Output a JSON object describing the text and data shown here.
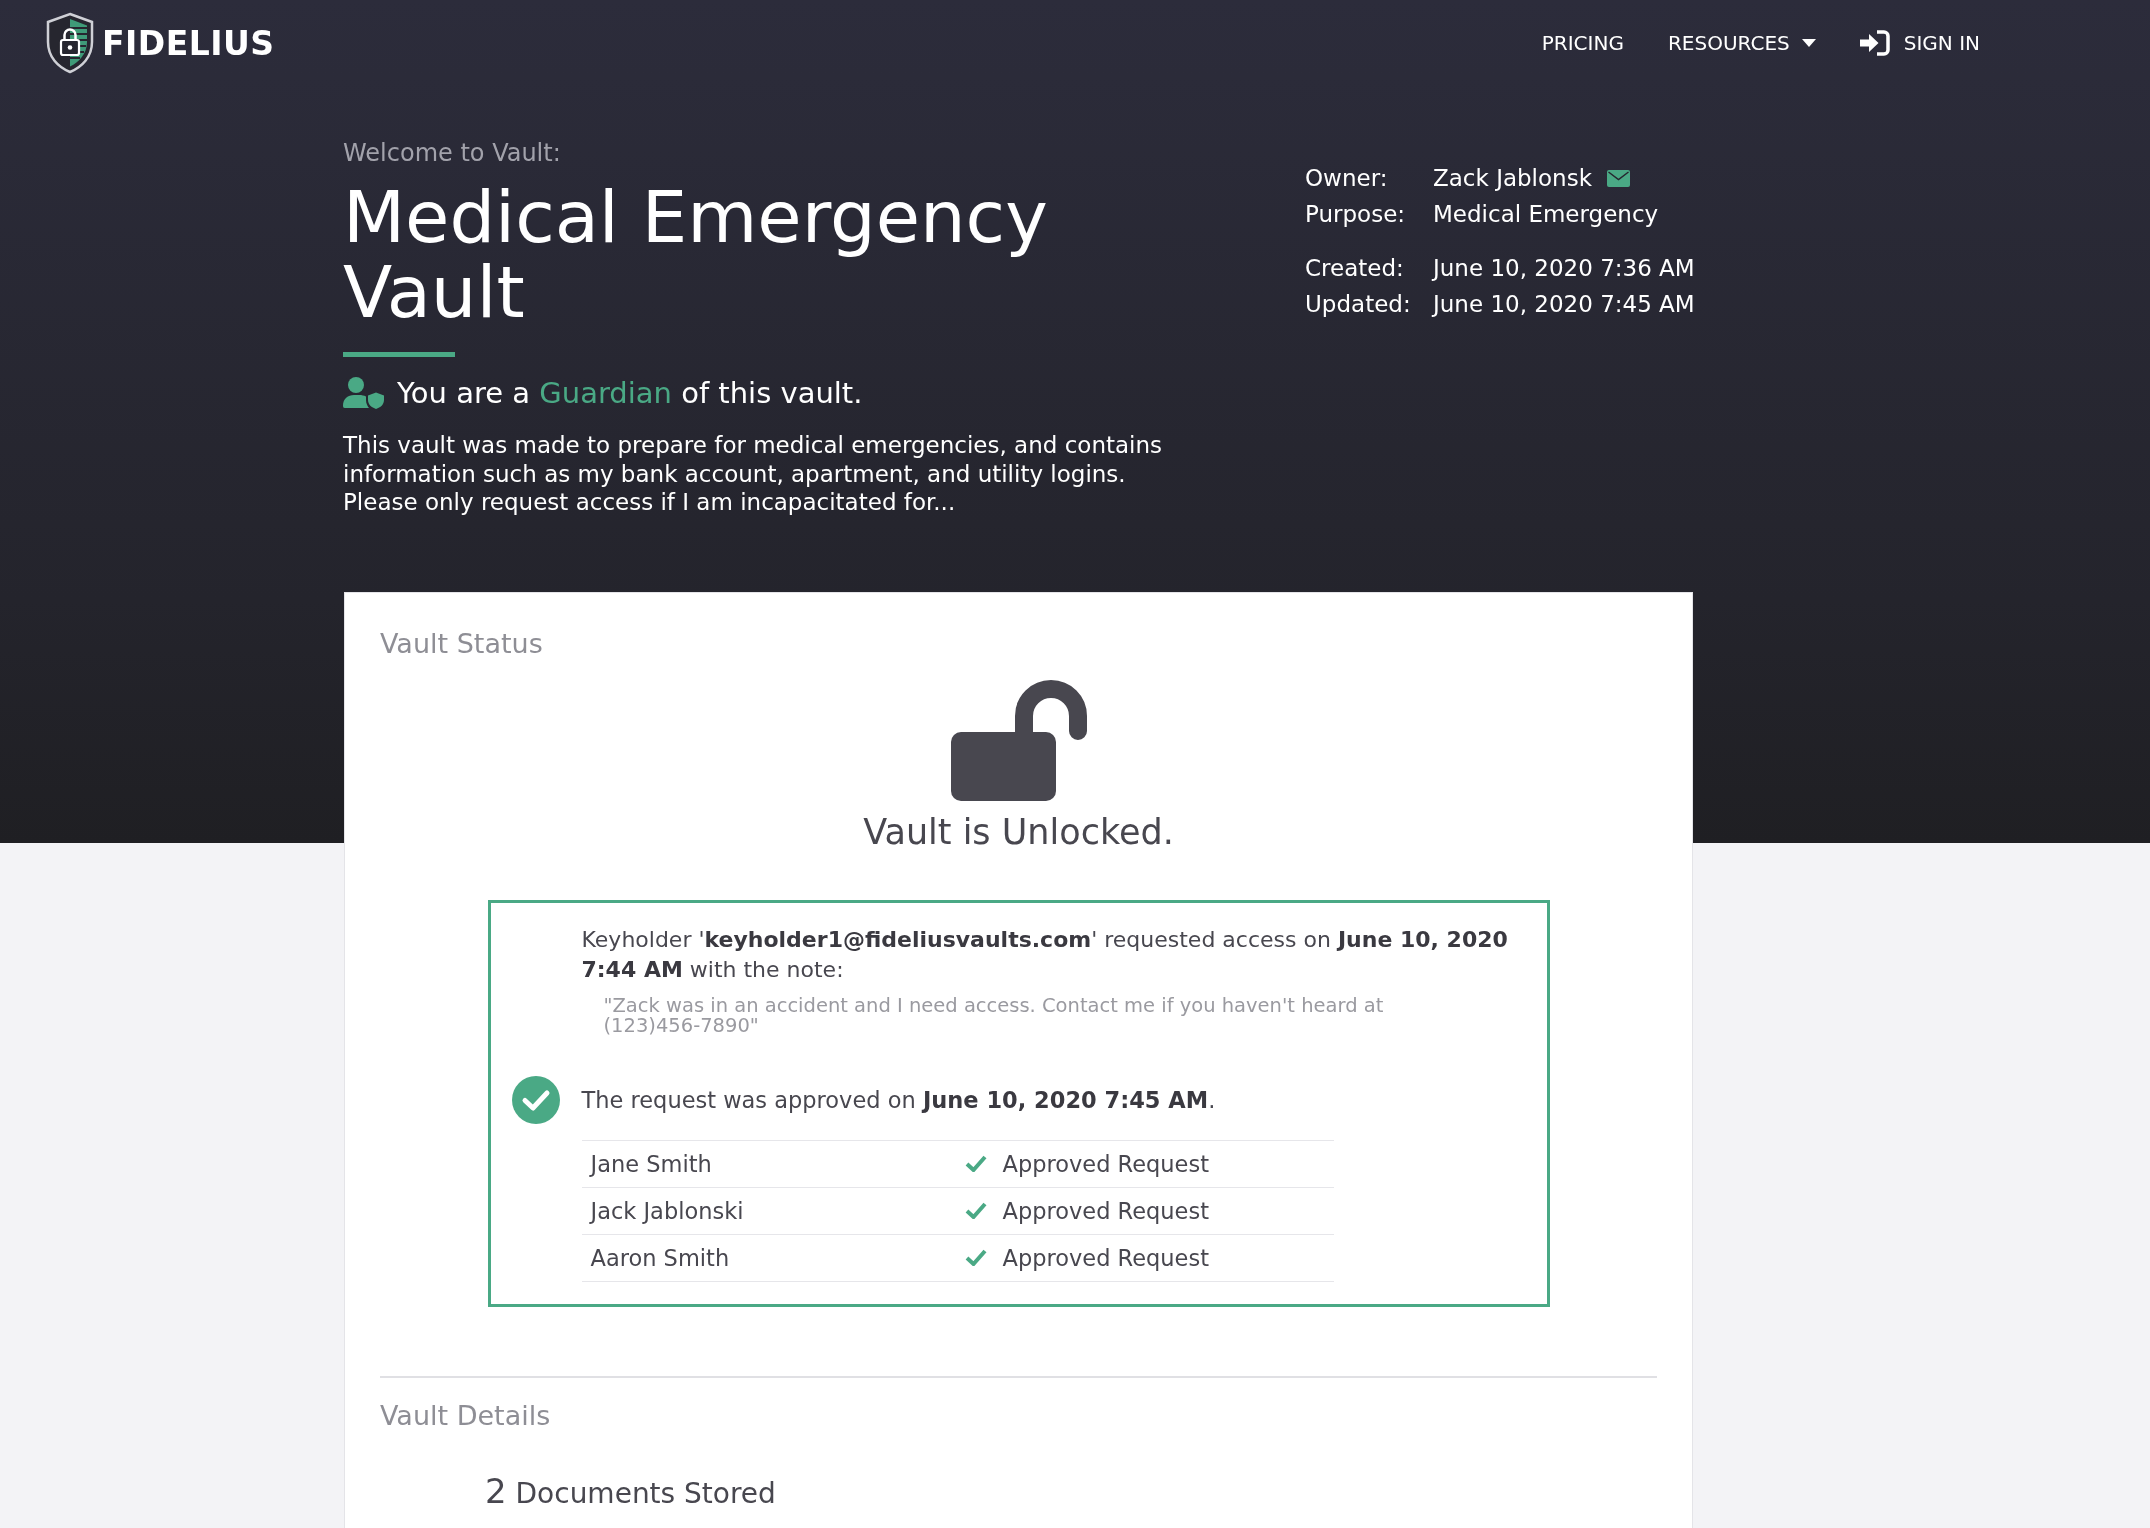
{
  "header": {
    "brand": "FIDELIUS",
    "nav": [
      {
        "label": "PRICING",
        "kind": "link"
      },
      {
        "label": "RESOURCES",
        "kind": "dropdown"
      },
      {
        "label": "SIGN IN",
        "kind": "signin"
      }
    ]
  },
  "hero": {
    "welcome": "Welcome to Vault:",
    "title": "Medical Emergency Vault",
    "role": {
      "prefix": "You are a",
      "role": "Guardian",
      "suffix": "of this vault."
    },
    "description": "This vault was made to prepare for medical emergencies, and contains information such as my bank account, apartment, and utility logins. Please only request access if I am incapacitated for..."
  },
  "info": [
    {
      "rows": [
        {
          "label": "Owner:",
          "value": "Zack Jablonsk",
          "kind": "contact"
        },
        {
          "label": "Purpose:",
          "value": "Medical Emergency",
          "kind": "text"
        }
      ]
    },
    {
      "rows": [
        {
          "label": "Created:",
          "value": "June 10, 2020 7:36 AM",
          "kind": "text"
        },
        {
          "label": "Updated:",
          "value": "June 10, 2020 7:45 AM",
          "kind": "text"
        }
      ]
    }
  ],
  "status_card": {
    "title": "Vault Status",
    "locked": false,
    "status_text": "Vault is Unlocked.",
    "request": {
      "message": "Keyholder '**keyholder1@fideliusvaults.com**' requested access on **June 10, 2020 7:44 AM** with the note:",
      "note": "\"Zack was in an accident and I need access. Contact me if you haven't heard at (123)456-7890\"",
      "approved": true,
      "approval_text": "The request was approved on **June 10, 2020 7:45 AM**.",
      "approvals": [
        {
          "name": "Jane Smith",
          "status": "Approved Request",
          "approved": true
        },
        {
          "name": "Jack Jablonski",
          "status": "Approved Request",
          "approved": true
        },
        {
          "name": "Aaron Smith",
          "status": "Approved Request",
          "approved": true
        }
      ]
    }
  },
  "details": {
    "title": "Vault Details",
    "count": "2",
    "count_label": "Documents Stored"
  }
}
